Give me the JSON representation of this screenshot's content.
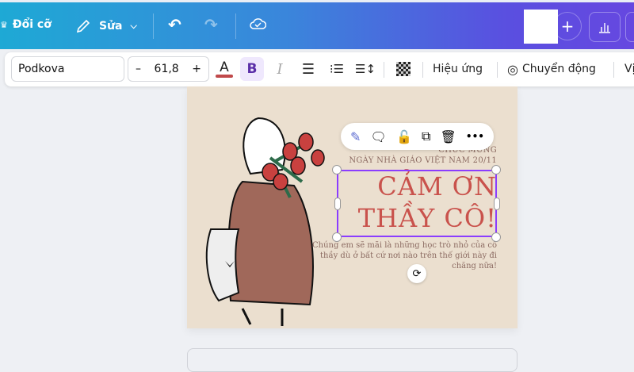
{
  "topbar": {
    "resize_label": "Đổi cỡ",
    "edit_label": "Sửa"
  },
  "toolbar": {
    "font": "Podkova",
    "font_size": "61,8",
    "minus": "–",
    "plus": "+",
    "text_color_letter": "A",
    "text_color": "#c0494a",
    "bold": "B",
    "italic": "I",
    "effects": "Hiệu ứng",
    "animate": "Chuyển động",
    "position_partial": "Vị"
  },
  "design": {
    "heading_small": "CHÚC MỪNG",
    "subheading": "NGÀY NHÀ GIÁO VIỆT NAM 20/11",
    "title_line1": "CẢM ƠN",
    "title_line2": "THẦY CÔ!",
    "paragraph": "Chúng em sẽ mãi là những học trò nhỏ của cô thầy dù ở bất cứ nơi nào trên thế giới này đi chăng nữa!"
  },
  "float_toolbar": {
    "more": "•••"
  },
  "colors": {
    "accent": "#8b3dff",
    "title": "#c9524c"
  }
}
